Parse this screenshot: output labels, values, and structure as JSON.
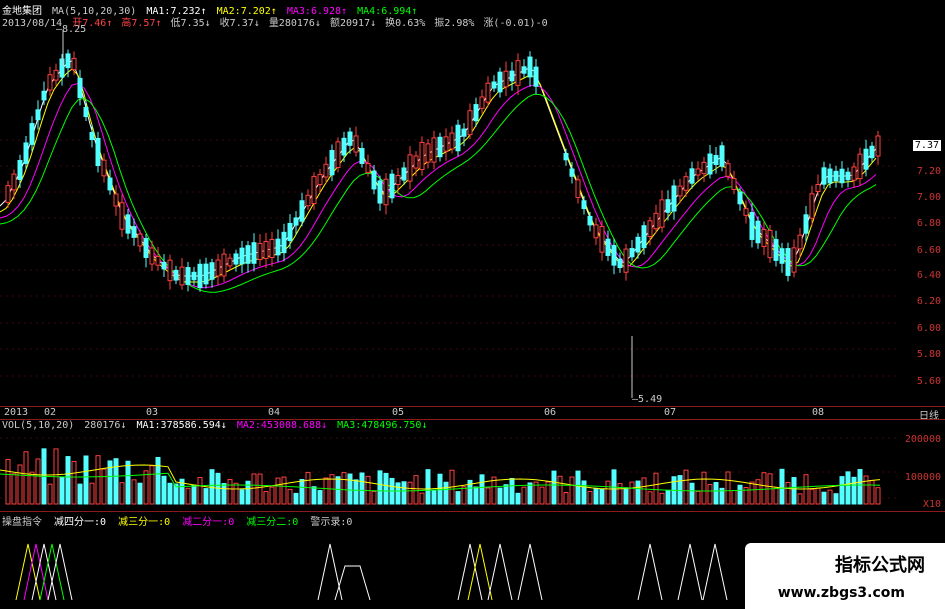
{
  "header": {
    "stock_name": "金地集团",
    "ma_params": "MA(5,10,20,30)",
    "ma1": "MA1:7.232↑",
    "ma2": "MA2:7.202↑",
    "ma3": "MA3:6.928↑",
    "ma4": "MA4:6.994↑",
    "date": "2013/08/14",
    "open": "开7.46↑",
    "high": "高7.57↑",
    "low": "低7.35↓",
    "close": "收7.37↓",
    "volume": "量280176↓",
    "amount": "额20917↓",
    "turnover": "换0.63%",
    "amplitude": "振2.98%",
    "change": "涨(-0.01)-0"
  },
  "price_axis": [
    "7.37",
    "7.20",
    "7.00",
    "6.80",
    "6.60",
    "6.40",
    "6.20",
    "6.00",
    "5.80",
    "5.60"
  ],
  "annotations": {
    "high_label": "8.25",
    "low_label": "5.49"
  },
  "date_axis": {
    "labels": [
      "2013",
      "02",
      "03",
      "04",
      "05",
      "06",
      "07",
      "08"
    ],
    "period": "日线"
  },
  "volume_header": {
    "params": "VOL(5,10,20)",
    "vol": "280176↓",
    "ma1": "MA1:378586.594↓",
    "ma2": "MA2:453008.688↓",
    "ma3": "MA3:478496.750↓"
  },
  "volume_axis": [
    "200000",
    "100000",
    "X10"
  ],
  "indicator_header": {
    "name": "操盘指令",
    "item1": "减四分一:0",
    "item2": "减三分一:0",
    "item3": "减二分一:0",
    "item4": "减三分二:0",
    "item5": "警示录:0"
  },
  "watermark": {
    "title": "指标公式网",
    "url": "www.zbgs3.com"
  },
  "colors": {
    "up": "#ff4040",
    "down": "#54ffff",
    "ma1": "#ffffff",
    "ma2": "#ffff00",
    "ma3": "#ff00ff",
    "ma4": "#00ff00",
    "grid": "#8b1a1a"
  }
}
